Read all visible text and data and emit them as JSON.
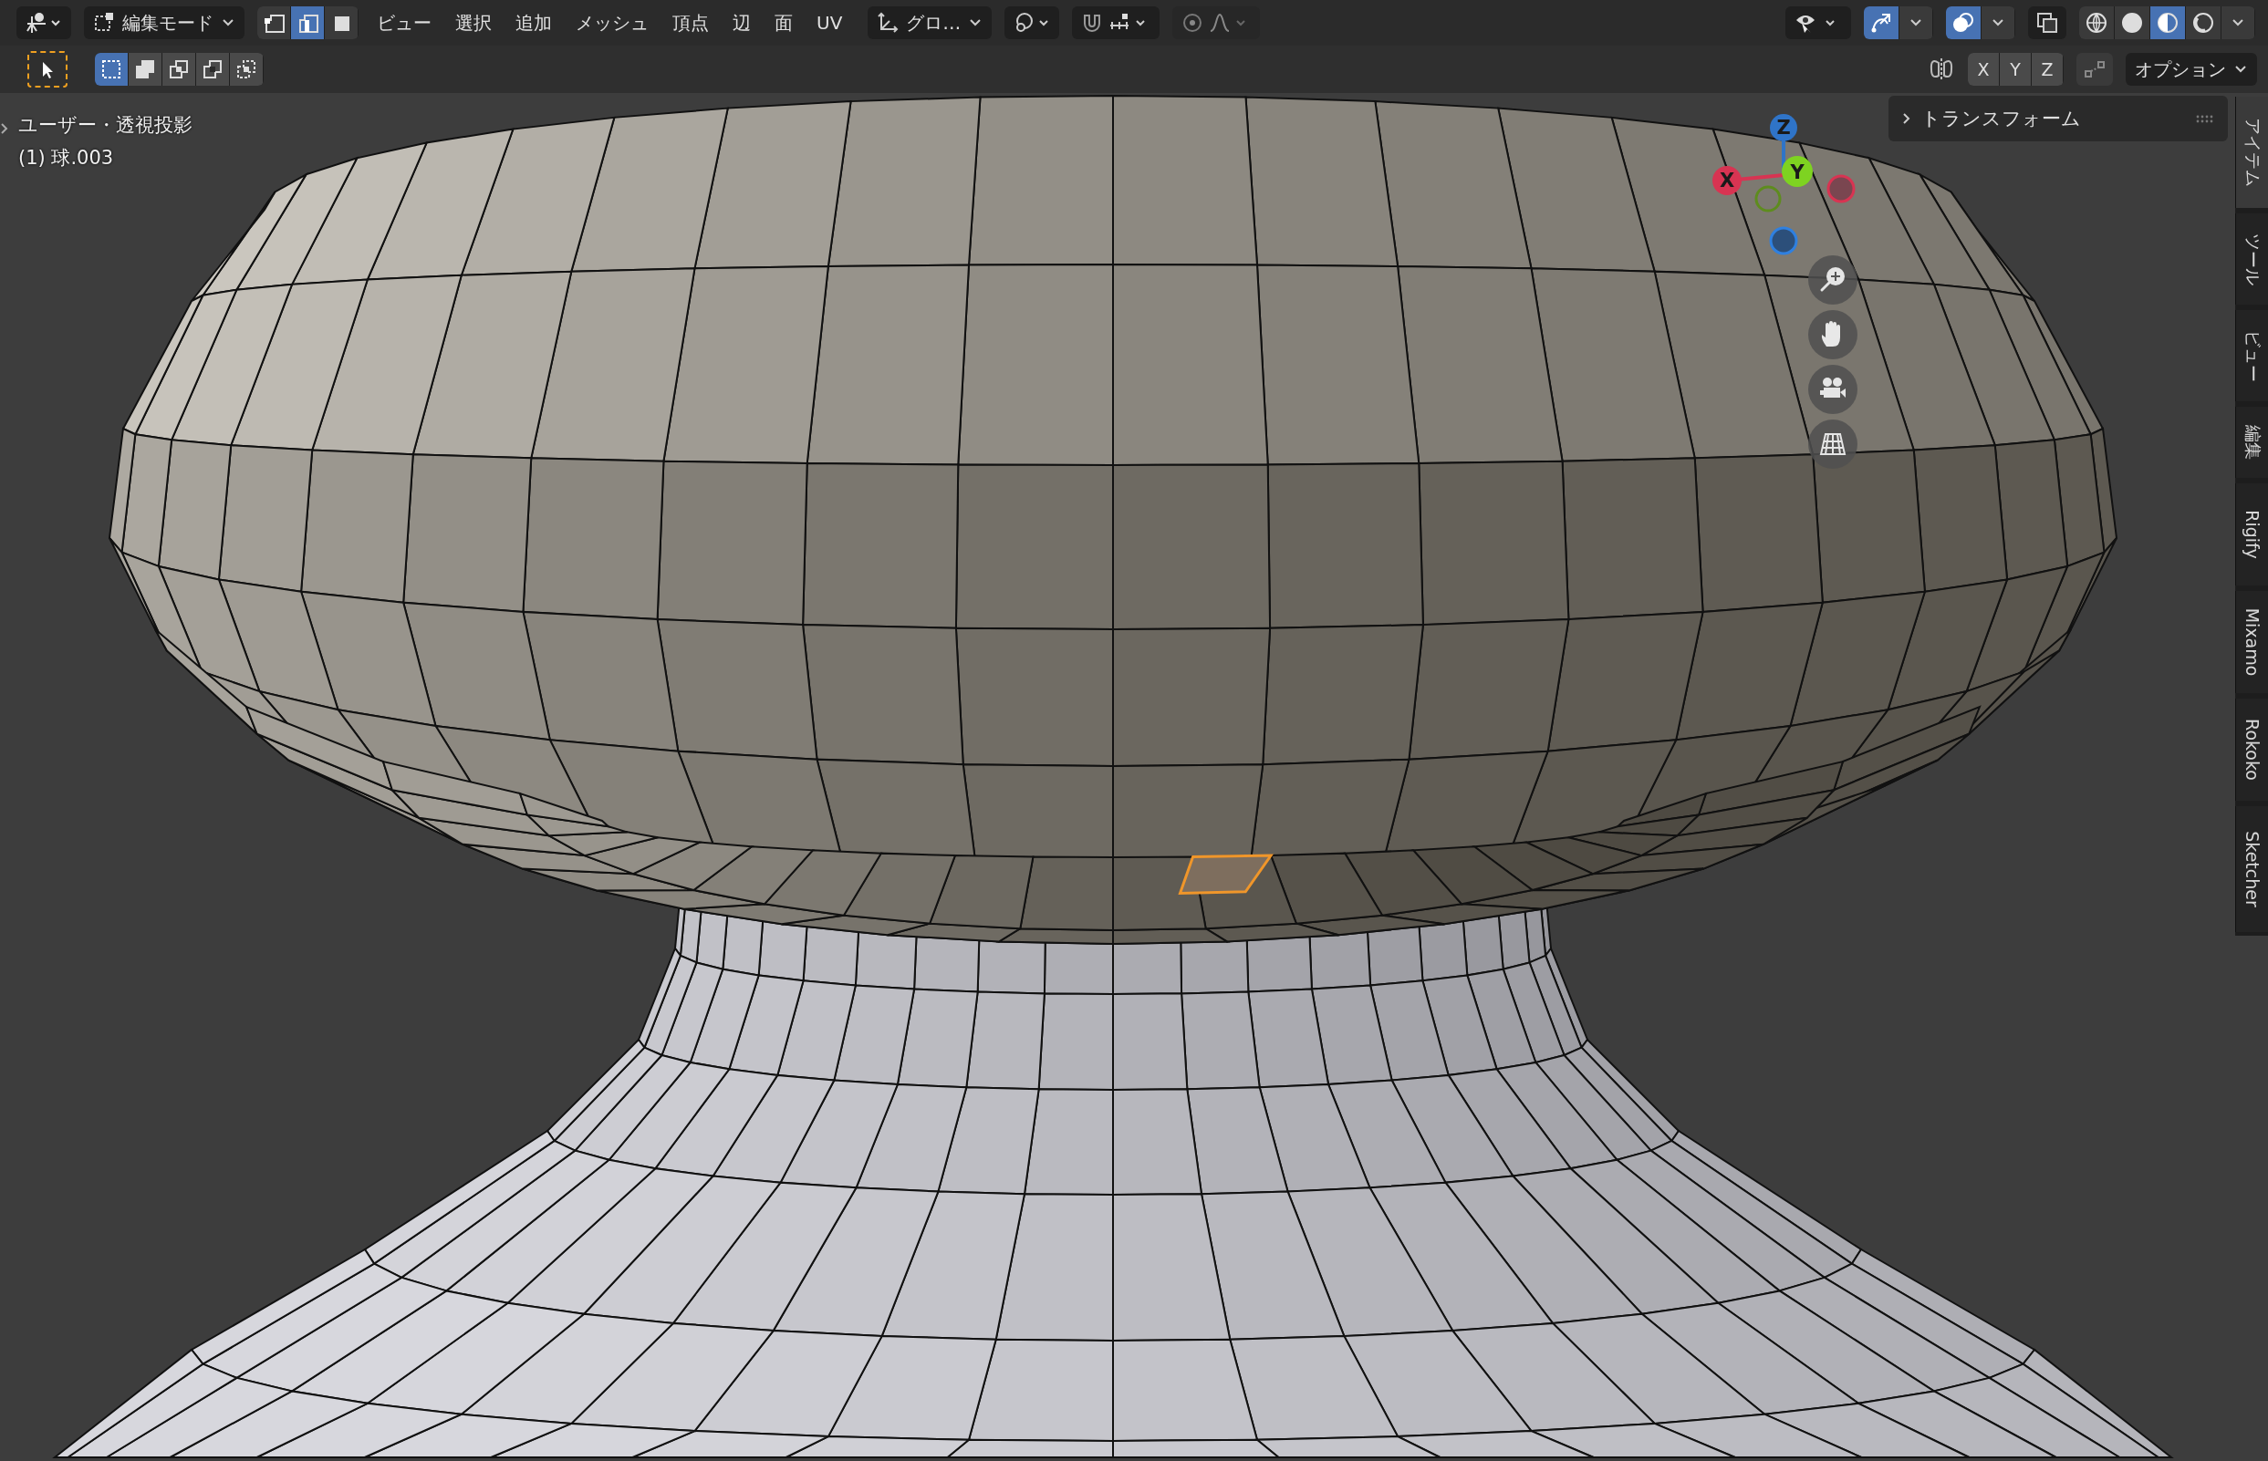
{
  "header": {
    "mode": "編集モード",
    "select_modes": [
      {
        "selected": false
      },
      {
        "selected": true
      },
      {
        "selected": false
      }
    ],
    "menus": [
      "ビュー",
      "選択",
      "追加",
      "メッシュ",
      "頂点",
      "辺",
      "面",
      "UV"
    ],
    "orientation": "グロ…",
    "gizmos_on": true,
    "overlays_on": true,
    "shading_modes": [
      {
        "selected": false
      },
      {
        "selected": false
      },
      {
        "selected": true
      },
      {
        "selected": false
      }
    ]
  },
  "tool_header": {
    "box_modes": [
      {
        "selected": true
      },
      {
        "selected": false
      },
      {
        "selected": false
      },
      {
        "selected": false
      },
      {
        "selected": false
      }
    ],
    "mirror_axes": [
      "X",
      "Y",
      "Z"
    ],
    "options": "オプション"
  },
  "viewport": {
    "view_name": "ユーザー・透視投影",
    "object": "(1) 球.003",
    "gizmo_axes": [
      "X",
      "Y",
      "Z"
    ]
  },
  "sidebar": {
    "panel": "トランスフォーム",
    "tabs": [
      {
        "label": "アイテム",
        "selected": true
      },
      {
        "label": "ツール",
        "selected": false
      },
      {
        "label": "ビュー",
        "selected": false
      },
      {
        "label": "編集",
        "selected": false
      },
      {
        "label": "Rigify",
        "selected": false
      },
      {
        "label": "Mixamo",
        "selected": false
      },
      {
        "label": "Rokoko",
        "selected": false
      },
      {
        "label": "Sketcher",
        "selected": false
      }
    ]
  }
}
